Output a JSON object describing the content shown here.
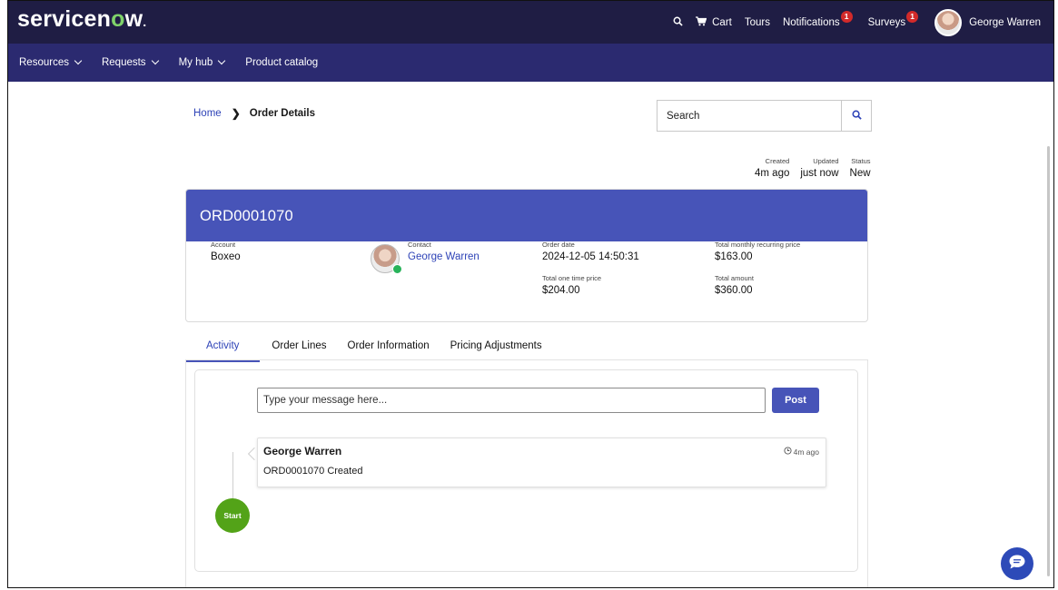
{
  "header": {
    "logo": "servicenow",
    "nav_right": {
      "cart": "Cart",
      "tours": "Tours",
      "notifications": "Notifications",
      "notifications_count": "1",
      "surveys": "Surveys",
      "surveys_count": "1",
      "user_name": "George Warren"
    }
  },
  "navbar": {
    "items": [
      {
        "label": "Resources"
      },
      {
        "label": "Requests"
      },
      {
        "label": "My hub"
      },
      {
        "label": "Product catalog"
      }
    ]
  },
  "breadcrumb": {
    "home": "Home",
    "current": "Order Details"
  },
  "search": {
    "placeholder": "Search"
  },
  "meta": {
    "created_label": "Created",
    "created_value": "4m ago",
    "updated_label": "Updated",
    "updated_value": "just now",
    "status_label": "Status",
    "status_value": "New"
  },
  "order": {
    "number": "ORD0001070",
    "account_label": "Account",
    "account_value": "Boxeo",
    "contact_label": "Contact",
    "contact_value": "George Warren",
    "order_date_label": "Order date",
    "order_date_value": "2024-12-05 14:50:31",
    "total_monthly_label": "Total monthly recurring price",
    "total_monthly_value": "$163.00",
    "total_one_time_label": "Total one time price",
    "total_one_time_value": "$204.00",
    "total_amount_label": "Total amount",
    "total_amount_value": "$360.00"
  },
  "tabs": [
    {
      "label": "Activity",
      "active": true
    },
    {
      "label": "Order Lines"
    },
    {
      "label": "Order Information"
    },
    {
      "label": "Pricing Adjustments"
    }
  ],
  "activity": {
    "message_placeholder": "Type your message here...",
    "post_label": "Post",
    "entries": [
      {
        "author": "George Warren",
        "text": "ORD0001070 Created",
        "time": "4m ago"
      }
    ],
    "start_label": "Start"
  },
  "colors": {
    "topbar": "#1f1d44",
    "navbar": "#2b2a70",
    "accent": "#4754b8",
    "link": "#2e43b7",
    "start": "#53a318",
    "badge": "#d22a2a"
  }
}
